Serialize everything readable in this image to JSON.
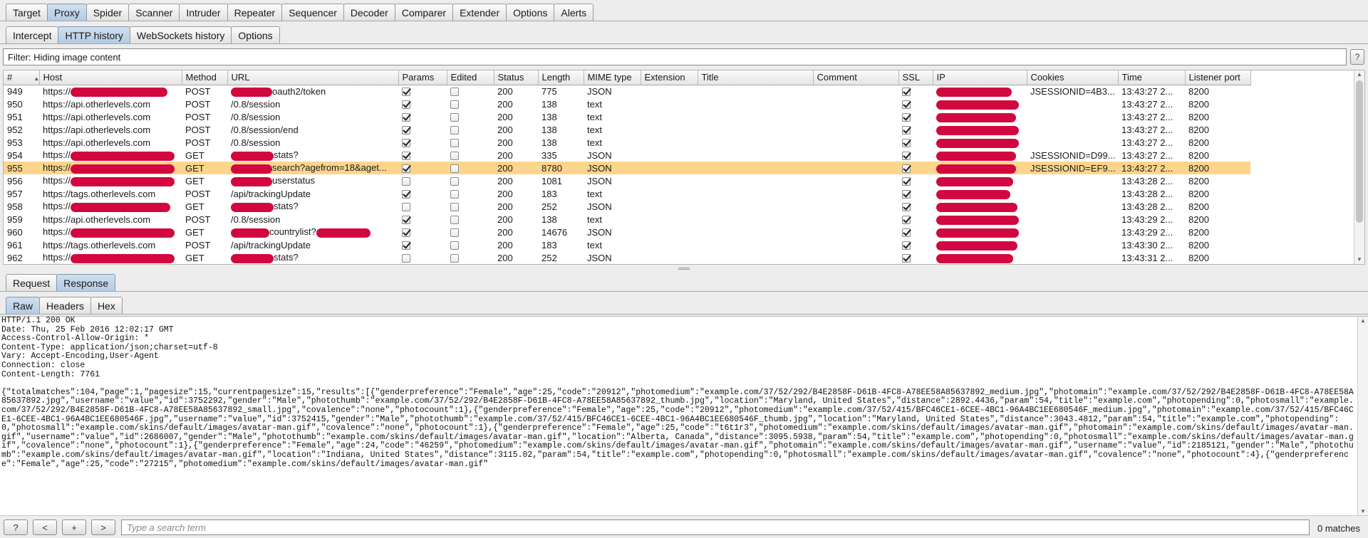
{
  "main_tabs": [
    "Target",
    "Proxy",
    "Spider",
    "Scanner",
    "Intruder",
    "Repeater",
    "Sequencer",
    "Decoder",
    "Comparer",
    "Extender",
    "Options",
    "Alerts"
  ],
  "sub_tabs": [
    "Intercept",
    "HTTP history",
    "WebSockets history",
    "Options"
  ],
  "filter": {
    "text": "Filter: Hiding image content",
    "help_label": "?"
  },
  "history": {
    "columns": [
      "#",
      "Host",
      "Method",
      "URL",
      "Params",
      "Edited",
      "Status",
      "Length",
      "MIME type",
      "Extension",
      "Title",
      "Comment",
      "SSL",
      "IP",
      "Cookies",
      "Time",
      "Listener port"
    ],
    "rows": [
      {
        "num": "949",
        "host": "https://",
        "method": "POST",
        "url": "oauth2/token",
        "params": true,
        "edited": false,
        "status": "200",
        "length": "775",
        "mime": "JSON",
        "ssl": true,
        "cookies": "JSESSIONID=4B3...",
        "time": "13:43:27 2...",
        "port": "8200"
      },
      {
        "num": "950",
        "host": "https://api.otherlevels.com",
        "method": "POST",
        "url": "/0.8/session",
        "params": true,
        "edited": false,
        "status": "200",
        "length": "138",
        "mime": "text",
        "ssl": true,
        "cookies": "",
        "time": "13:43:27 2...",
        "port": "8200"
      },
      {
        "num": "951",
        "host": "https://api.otherlevels.com",
        "method": "POST",
        "url": "/0.8/session",
        "params": true,
        "edited": false,
        "status": "200",
        "length": "138",
        "mime": "text",
        "ssl": true,
        "cookies": "",
        "time": "13:43:27 2...",
        "port": "8200"
      },
      {
        "num": "952",
        "host": "https://api.otherlevels.com",
        "method": "POST",
        "url": "/0.8/session/end",
        "params": true,
        "edited": false,
        "status": "200",
        "length": "138",
        "mime": "text",
        "ssl": true,
        "cookies": "",
        "time": "13:43:27 2...",
        "port": "8200"
      },
      {
        "num": "953",
        "host": "https://api.otherlevels.com",
        "method": "POST",
        "url": "/0.8/session",
        "params": true,
        "edited": false,
        "status": "200",
        "length": "138",
        "mime": "text",
        "ssl": true,
        "cookies": "",
        "time": "13:43:27 2...",
        "port": "8200"
      },
      {
        "num": "954",
        "host": "https://",
        "method": "GET",
        "url": "stats?",
        "params": true,
        "edited": false,
        "status": "200",
        "length": "335",
        "mime": "JSON",
        "ssl": true,
        "cookies": "JSESSIONID=D99...",
        "time": "13:43:27 2...",
        "port": "8200"
      },
      {
        "num": "955",
        "host": "https://",
        "method": "GET",
        "url": "search?agefrom=18&aget...",
        "params": true,
        "edited": false,
        "status": "200",
        "length": "8780",
        "mime": "JSON",
        "ssl": true,
        "cookies": "JSESSIONID=EF9...",
        "time": "13:43:27 2...",
        "port": "8200",
        "selected": true
      },
      {
        "num": "956",
        "host": "https://",
        "method": "GET",
        "url": "userstatus",
        "params": false,
        "edited": false,
        "status": "200",
        "length": "1081",
        "mime": "JSON",
        "ssl": true,
        "cookies": "",
        "time": "13:43:28 2...",
        "port": "8200"
      },
      {
        "num": "957",
        "host": "https://tags.otherlevels.com",
        "method": "POST",
        "url": "/api/trackingUpdate",
        "params": true,
        "edited": false,
        "status": "200",
        "length": "183",
        "mime": "text",
        "ssl": true,
        "cookies": "",
        "time": "13:43:28 2...",
        "port": "8200"
      },
      {
        "num": "958",
        "host": "https://",
        "method": "GET",
        "url": "stats?",
        "params": false,
        "edited": false,
        "status": "200",
        "length": "252",
        "mime": "JSON",
        "ssl": true,
        "cookies": "",
        "time": "13:43:28 2...",
        "port": "8200"
      },
      {
        "num": "959",
        "host": "https://api.otherlevels.com",
        "method": "POST",
        "url": "/0.8/session",
        "params": true,
        "edited": false,
        "status": "200",
        "length": "138",
        "mime": "text",
        "ssl": true,
        "cookies": "",
        "time": "13:43:29 2...",
        "port": "8200"
      },
      {
        "num": "960",
        "host": "https://",
        "method": "GET",
        "url": "countrylist?",
        "params": true,
        "edited": false,
        "status": "200",
        "length": "14676",
        "mime": "JSON",
        "ssl": true,
        "cookies": "",
        "time": "13:43:29 2...",
        "port": "8200"
      },
      {
        "num": "961",
        "host": "https://tags.otherlevels.com",
        "method": "POST",
        "url": "/api/trackingUpdate",
        "params": true,
        "edited": false,
        "status": "200",
        "length": "183",
        "mime": "text",
        "ssl": true,
        "cookies": "",
        "time": "13:43:30 2...",
        "port": "8200"
      },
      {
        "num": "962",
        "host": "https://",
        "method": "GET",
        "url": "stats?",
        "params": false,
        "edited": false,
        "status": "200",
        "length": "252",
        "mime": "JSON",
        "ssl": true,
        "cookies": "",
        "time": "13:43:31 2...",
        "port": "8200"
      }
    ]
  },
  "rr_tabs": [
    "Request",
    "Response"
  ],
  "view_tabs": [
    "Raw",
    "Headers",
    "Hex"
  ],
  "response": {
    "raw": "HTTP/1.1 200 OK\nDate: Thu, 25 Feb 2016 12:02:17 GMT\nAccess-Control-Allow-Origin: *\nContent-Type: application/json;charset=utf-8\nVary: Accept-Encoding,User-Agent\nConnection: close\nContent-Length: 7761\n\n{\"totalmatches\":104,\"page\":1,\"pagesize\":15,\"currentpagesize\":15,\"results\":[{\"genderpreference\":\"Female\",\"age\":25,\"code\":\"20912\",\"photomedium\":\"example.com/37/52/292/B4E2858F-D61B-4FC8-A78EE58A85637892_medium.jpg\",\"photomain\":\"example.com/37/52/292/B4E2858F-D61B-4FC8-A78EE58A85637892.jpg\",\"username\":\"value\",\"id\":3752292,\"gender\":\"Male\",\"photothumb\":\"example.com/37/52/292/B4E2858F-D61B-4FC8-A78EE58A85637892_thumb.jpg\",\"location\":\"Maryland, United States\",\"distance\":2892.4436,\"param\":54,\"title\":\"example.com\",\"photopending\":0,\"photosmall\":\"example.com/37/52/292/B4E2858F-D61B-4FC8-A78EE58A85637892_small.jpg\",\"covalence\":\"none\",\"photocount\":1},{\"genderpreference\":\"Female\",\"age\":25,\"code\":\"20912\",\"photomedium\":\"example.com/37/52/415/BFC46CE1-6CEE-4BC1-96A4BC1EE680546F_medium.jpg\",\"photomain\":\"example.com/37/52/415/BFC46CE1-6CEE-4BC1-96A4BC1EE680546F.jpg\",\"username\":\"value\",\"id\":3752415,\"gender\":\"Male\",\"photothumb\":\"example.com/37/52/415/BFC46CE1-6CEE-4BC1-96A4BC1EE680546F_thumb.jpg\",\"location\":\"Maryland, United States\",\"distance\":3043.4812,\"param\":54,\"title\":\"example.com\",\"photopending\":0,\"photosmall\":\"example.com/skins/default/images/avatar-man.gif\",\"covalence\":\"none\",\"photocount\":1},{\"genderpreference\":\"Female\",\"age\":25,\"code\":\"t6t1r3\",\"photomedium\":\"example.com/skins/default/images/avatar-man.gif\",\"photomain\":\"example.com/skins/default/images/avatar-man.gif\",\"username\":\"value\",\"id\":2686007,\"gender\":\"Male\",\"photothumb\":\"example.com/skins/default/images/avatar-man.gif\",\"location\":\"Alberta, Canada\",\"distance\":3095.5938,\"param\":54,\"title\":\"example.com\",\"photopending\":0,\"photosmall\":\"example.com/skins/default/images/avatar-man.gif\",\"covalence\":\"none\",\"photocount\":1},{\"genderpreference\":\"Female\",\"age\":24,\"code\":\"46259\",\"photomedium\":\"example.com/skins/default/images/avatar-man.gif\",\"photomain\":\"example.com/skins/default/images/avatar-man.gif\",\"username\":\"value\",\"id\":2185121,\"gender\":\"Male\",\"photothumb\":\"example.com/skins/default/images/avatar-man.gif\",\"location\":\"Indiana, United States\",\"distance\":3115.02,\"param\":54,\"title\":\"example.com\",\"photopending\":0,\"photosmall\":\"example.com/skins/default/images/avatar-man.gif\",\"covalence\":\"none\",\"photocount\":4},{\"genderpreference\":\"Female\",\"age\":25,\"code\":\"27215\",\"photomedium\":\"example.com/skins/default/images/avatar-man.gif\""
  },
  "search": {
    "buttons": [
      "?",
      "<",
      "+",
      ">"
    ],
    "placeholder": "Type a search term",
    "matches": "0 matches"
  },
  "colors": {
    "selected_row": "#fdd58c",
    "redaction": "#d3073f",
    "active_tab": "#b4cbe3"
  }
}
